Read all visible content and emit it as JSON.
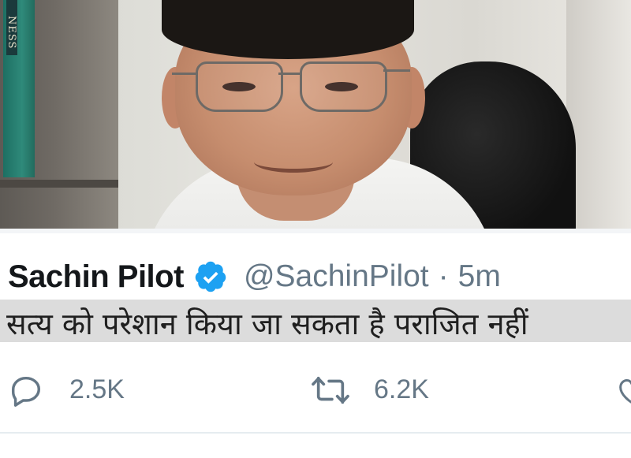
{
  "tweet": {
    "author_name": "Sachin Pilot",
    "handle": "@SachinPilot",
    "separator": "·",
    "time": "5m",
    "text": "सत्य को परेशान किया जा सकता है पराजित नहीं",
    "verified": true
  },
  "photo": {
    "book_spine_text": "NESS"
  },
  "actions": {
    "reply_count": "2.5K",
    "retweet_count": "6.2K"
  },
  "colors": {
    "text": "#14171a",
    "muted": "#657786",
    "verified_badge": "#1da1f2",
    "highlight": "#dcdcdc"
  },
  "icons": [
    "reply-icon",
    "retweet-icon",
    "like-icon",
    "verified-badge-icon"
  ]
}
